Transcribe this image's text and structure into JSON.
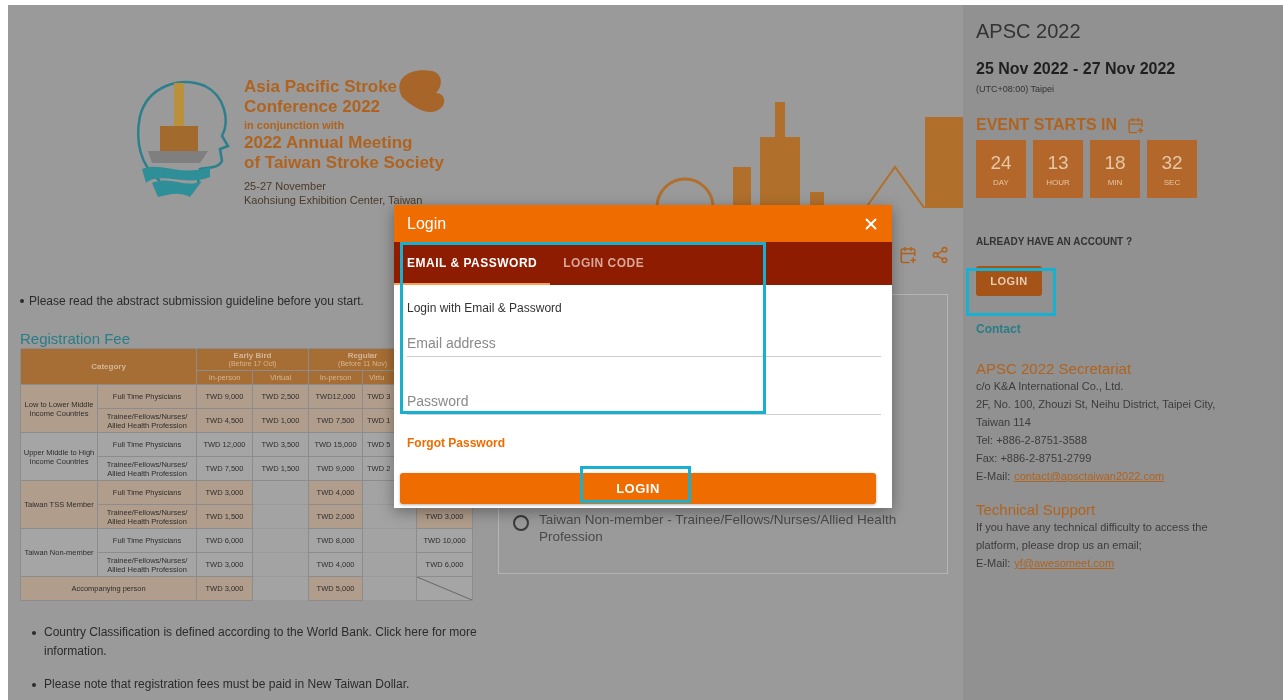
{
  "banner": {
    "title_lines": [
      "Asia Pacific Stroke",
      "Conference 2022"
    ],
    "subtitle": "in conjunction with",
    "meeting_lines": [
      "2022 Annual Meeting",
      "of Taiwan Stroke Society"
    ],
    "dates": "25-27 November",
    "venue": "Kaohsiung Exhibition Center, Taiwan"
  },
  "notice": "Please read the abstract submission guideline before you start.",
  "registration": {
    "title": "Registration Fee",
    "header": {
      "category": "Category",
      "groups": [
        {
          "label": "Early Bird",
          "note": "(Before 17 Oct)"
        },
        {
          "label": "Regular",
          "note": "(Before 11 Nov)"
        }
      ],
      "columns": [
        "In-person",
        "Virtual",
        "In-person",
        "Virtu"
      ]
    },
    "groups": [
      {
        "kind": "grouped",
        "name": "Low to Lower Middle Income Countries",
        "rows": [
          {
            "category": "Full Time Physicians",
            "early_in_person": "TWD 9,000",
            "early_virtual": "TWD 2,500",
            "regular_in_person": "TWD12,000",
            "regular_virtual": "TWD 3"
          },
          {
            "category": "Trainee/Fellows/Nurses/ Allied Health Profession",
            "early_in_person": "TWD 4,500",
            "early_virtual": "TWD 1,000",
            "regular_in_person": "TWD 7,500",
            "regular_virtual": "TWD 1"
          }
        ]
      },
      {
        "kind": "grouped",
        "name": "Upper Middle to High Income Countries",
        "rows": [
          {
            "category": "Full Time Physicians",
            "early_in_person": "TWD 12,000",
            "early_virtual": "TWD 3,500",
            "regular_in_person": "TWD 15,000",
            "regular_virtual": "TWD 5"
          },
          {
            "category": "Trainee/Fellows/Nurses/ Allied Health Profession",
            "early_in_person": "TWD 7,500",
            "early_virtual": "TWD 1,500",
            "regular_in_person": "TWD 9,000",
            "regular_virtual": "TWD 2"
          }
        ]
      },
      {
        "kind": "grouped",
        "name": "Taiwan TSS Member",
        "rows": [
          {
            "category": "Full Time Physicians",
            "early_in_person": "TWD 3,000",
            "regular_in_person": "TWD 4,000"
          },
          {
            "category": "Trainee/Fellows/Nurses/ Allied Health Profession",
            "early_in_person": "TWD 1,500",
            "regular_in_person": "TWD 2,000",
            "column_7": "TWD 3,000"
          }
        ]
      },
      {
        "kind": "grouped",
        "name": "Taiwan Non-member",
        "rows": [
          {
            "category": "Full Time Physicians",
            "early_in_person": "TWD 6,000",
            "regular_in_person": "TWD 8,000",
            "column_7": "TWD 10,000"
          },
          {
            "category": "Trainee/Fellows/Nurses/ Allied Health Profession",
            "early_in_person": "TWD 3,000",
            "regular_in_person": "TWD 4,000",
            "column_7": "TWD 6,000"
          }
        ]
      },
      {
        "kind": "single",
        "rows": [
          {
            "category": "Accompanying person",
            "early_in_person": "TWD 3,000",
            "regular_in_person": "TWD 5,000",
            "column_7_crossed": true
          }
        ]
      }
    ]
  },
  "notes": [
    "Country Classification is defined according to the World Bank. Click here for more information.",
    "Please note that registration fees must be paid in New Taiwan Dollar."
  ],
  "options": [
    {
      "label": "Taiwan Non-member - Trainee/Fellows/Nurses/Allied Health Profession",
      "selected": false
    }
  ],
  "sidebar": {
    "title": "APSC 2022",
    "date_range": "25 Nov 2022 - 27 Nov 2022",
    "timezone": "(UTC+08:00) Taipei",
    "countdown_title": "EVENT STARTS IN",
    "countdown": [
      {
        "value": "24",
        "unit": "DAY"
      },
      {
        "value": "13",
        "unit": "HOUR"
      },
      {
        "value": "18",
        "unit": "MIN"
      },
      {
        "value": "32",
        "unit": "SEC"
      }
    ],
    "account_prompt": "ALREADY HAVE AN ACCOUNT ?",
    "login_button": "LOGIN",
    "contact_title": "Contact",
    "secretariat": {
      "title": "APSC 2022 Secretariat",
      "lines": [
        "c/o K&A International Co., Ltd.",
        "2F, No. 100, Zhouzi St, Neihu District, Taipei City, Taiwan 114",
        "Tel: +886-2-8751-3588",
        "Fax: +886-2-8751-2799"
      ],
      "email_label": "E-Mail:",
      "email": "contact@apsctaiwan2022.com"
    },
    "support": {
      "title": "Technical Support",
      "text": "If you have any technical difficulty to access the platform, please drop us an email;",
      "email_label": "E-Mail:",
      "email": "yf@awesomeet.com"
    }
  },
  "modal": {
    "title": "Login",
    "tabs": [
      {
        "label": "EMAIL & PASSWORD",
        "selected": true
      },
      {
        "label": "LOGIN CODE",
        "selected": false
      }
    ],
    "intro": "Login with Email & Password",
    "fields": [
      {
        "placeholder": "Email address"
      },
      {
        "placeholder": "Password"
      }
    ],
    "forgot_link": "Forgot Password",
    "submit": "LOGIN"
  }
}
